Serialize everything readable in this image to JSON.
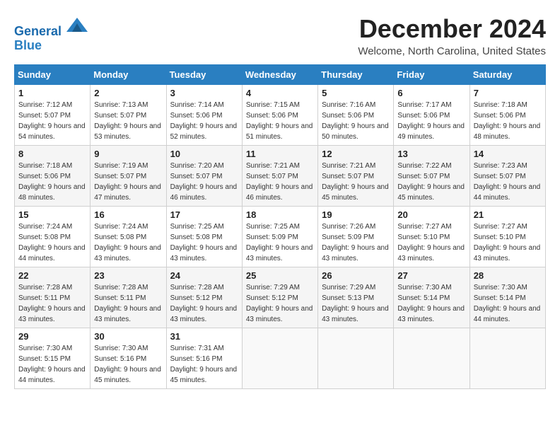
{
  "header": {
    "logo_line1": "General",
    "logo_line2": "Blue",
    "month_title": "December 2024",
    "location": "Welcome, North Carolina, United States"
  },
  "days_of_week": [
    "Sunday",
    "Monday",
    "Tuesday",
    "Wednesday",
    "Thursday",
    "Friday",
    "Saturday"
  ],
  "weeks": [
    [
      {
        "day": "1",
        "sunrise": "Sunrise: 7:12 AM",
        "sunset": "Sunset: 5:07 PM",
        "daylight": "Daylight: 9 hours and 54 minutes."
      },
      {
        "day": "2",
        "sunrise": "Sunrise: 7:13 AM",
        "sunset": "Sunset: 5:07 PM",
        "daylight": "Daylight: 9 hours and 53 minutes."
      },
      {
        "day": "3",
        "sunrise": "Sunrise: 7:14 AM",
        "sunset": "Sunset: 5:06 PM",
        "daylight": "Daylight: 9 hours and 52 minutes."
      },
      {
        "day": "4",
        "sunrise": "Sunrise: 7:15 AM",
        "sunset": "Sunset: 5:06 PM",
        "daylight": "Daylight: 9 hours and 51 minutes."
      },
      {
        "day": "5",
        "sunrise": "Sunrise: 7:16 AM",
        "sunset": "Sunset: 5:06 PM",
        "daylight": "Daylight: 9 hours and 50 minutes."
      },
      {
        "day": "6",
        "sunrise": "Sunrise: 7:17 AM",
        "sunset": "Sunset: 5:06 PM",
        "daylight": "Daylight: 9 hours and 49 minutes."
      },
      {
        "day": "7",
        "sunrise": "Sunrise: 7:18 AM",
        "sunset": "Sunset: 5:06 PM",
        "daylight": "Daylight: 9 hours and 48 minutes."
      }
    ],
    [
      {
        "day": "8",
        "sunrise": "Sunrise: 7:18 AM",
        "sunset": "Sunset: 5:06 PM",
        "daylight": "Daylight: 9 hours and 48 minutes."
      },
      {
        "day": "9",
        "sunrise": "Sunrise: 7:19 AM",
        "sunset": "Sunset: 5:07 PM",
        "daylight": "Daylight: 9 hours and 47 minutes."
      },
      {
        "day": "10",
        "sunrise": "Sunrise: 7:20 AM",
        "sunset": "Sunset: 5:07 PM",
        "daylight": "Daylight: 9 hours and 46 minutes."
      },
      {
        "day": "11",
        "sunrise": "Sunrise: 7:21 AM",
        "sunset": "Sunset: 5:07 PM",
        "daylight": "Daylight: 9 hours and 46 minutes."
      },
      {
        "day": "12",
        "sunrise": "Sunrise: 7:21 AM",
        "sunset": "Sunset: 5:07 PM",
        "daylight": "Daylight: 9 hours and 45 minutes."
      },
      {
        "day": "13",
        "sunrise": "Sunrise: 7:22 AM",
        "sunset": "Sunset: 5:07 PM",
        "daylight": "Daylight: 9 hours and 45 minutes."
      },
      {
        "day": "14",
        "sunrise": "Sunrise: 7:23 AM",
        "sunset": "Sunset: 5:07 PM",
        "daylight": "Daylight: 9 hours and 44 minutes."
      }
    ],
    [
      {
        "day": "15",
        "sunrise": "Sunrise: 7:24 AM",
        "sunset": "Sunset: 5:08 PM",
        "daylight": "Daylight: 9 hours and 44 minutes."
      },
      {
        "day": "16",
        "sunrise": "Sunrise: 7:24 AM",
        "sunset": "Sunset: 5:08 PM",
        "daylight": "Daylight: 9 hours and 43 minutes."
      },
      {
        "day": "17",
        "sunrise": "Sunrise: 7:25 AM",
        "sunset": "Sunset: 5:08 PM",
        "daylight": "Daylight: 9 hours and 43 minutes."
      },
      {
        "day": "18",
        "sunrise": "Sunrise: 7:25 AM",
        "sunset": "Sunset: 5:09 PM",
        "daylight": "Daylight: 9 hours and 43 minutes."
      },
      {
        "day": "19",
        "sunrise": "Sunrise: 7:26 AM",
        "sunset": "Sunset: 5:09 PM",
        "daylight": "Daylight: 9 hours and 43 minutes."
      },
      {
        "day": "20",
        "sunrise": "Sunrise: 7:27 AM",
        "sunset": "Sunset: 5:10 PM",
        "daylight": "Daylight: 9 hours and 43 minutes."
      },
      {
        "day": "21",
        "sunrise": "Sunrise: 7:27 AM",
        "sunset": "Sunset: 5:10 PM",
        "daylight": "Daylight: 9 hours and 43 minutes."
      }
    ],
    [
      {
        "day": "22",
        "sunrise": "Sunrise: 7:28 AM",
        "sunset": "Sunset: 5:11 PM",
        "daylight": "Daylight: 9 hours and 43 minutes."
      },
      {
        "day": "23",
        "sunrise": "Sunrise: 7:28 AM",
        "sunset": "Sunset: 5:11 PM",
        "daylight": "Daylight: 9 hours and 43 minutes."
      },
      {
        "day": "24",
        "sunrise": "Sunrise: 7:28 AM",
        "sunset": "Sunset: 5:12 PM",
        "daylight": "Daylight: 9 hours and 43 minutes."
      },
      {
        "day": "25",
        "sunrise": "Sunrise: 7:29 AM",
        "sunset": "Sunset: 5:12 PM",
        "daylight": "Daylight: 9 hours and 43 minutes."
      },
      {
        "day": "26",
        "sunrise": "Sunrise: 7:29 AM",
        "sunset": "Sunset: 5:13 PM",
        "daylight": "Daylight: 9 hours and 43 minutes."
      },
      {
        "day": "27",
        "sunrise": "Sunrise: 7:30 AM",
        "sunset": "Sunset: 5:14 PM",
        "daylight": "Daylight: 9 hours and 43 minutes."
      },
      {
        "day": "28",
        "sunrise": "Sunrise: 7:30 AM",
        "sunset": "Sunset: 5:14 PM",
        "daylight": "Daylight: 9 hours and 44 minutes."
      }
    ],
    [
      {
        "day": "29",
        "sunrise": "Sunrise: 7:30 AM",
        "sunset": "Sunset: 5:15 PM",
        "daylight": "Daylight: 9 hours and 44 minutes."
      },
      {
        "day": "30",
        "sunrise": "Sunrise: 7:30 AM",
        "sunset": "Sunset: 5:16 PM",
        "daylight": "Daylight: 9 hours and 45 minutes."
      },
      {
        "day": "31",
        "sunrise": "Sunrise: 7:31 AM",
        "sunset": "Sunset: 5:16 PM",
        "daylight": "Daylight: 9 hours and 45 minutes."
      },
      null,
      null,
      null,
      null
    ]
  ]
}
